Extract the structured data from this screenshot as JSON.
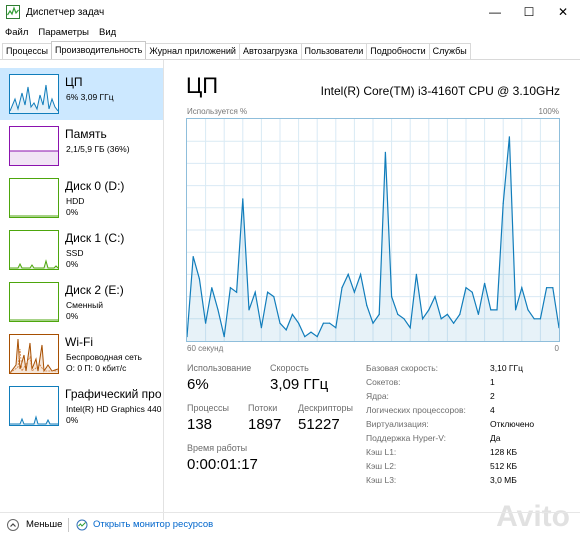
{
  "window": {
    "title": "Диспетчер задач",
    "minimize_glyph": "—",
    "maximize_glyph": "☐",
    "close_glyph": "✕"
  },
  "menu": [
    "Файл",
    "Параметры",
    "Вид"
  ],
  "tabs": [
    "Процессы",
    "Производительность",
    "Журнал приложений",
    "Автозагрузка",
    "Пользователи",
    "Подробности",
    "Службы"
  ],
  "active_tab": "Производительность",
  "sidebar": {
    "items": [
      {
        "title": "ЦП",
        "lines": [
          "6% 3,09 ГГц"
        ],
        "color": "#117dbb"
      },
      {
        "title": "Память",
        "lines": [
          "2,1/5,9 ГБ (36%)"
        ],
        "color": "#8b12ae"
      },
      {
        "title": "Диск 0 (D:)",
        "lines": [
          "HDD",
          "0%"
        ],
        "color": "#4da60c"
      },
      {
        "title": "Диск 1 (C:)",
        "lines": [
          "SSD",
          "0%"
        ],
        "color": "#4da60c"
      },
      {
        "title": "Диск 2 (E:)",
        "lines": [
          "Сменный",
          "0%"
        ],
        "color": "#4da60c"
      },
      {
        "title": "Wi-Fi",
        "lines": [
          "Беспроводная сеть",
          "О: 0 П: 0 кбит/с"
        ],
        "color": "#a74f01"
      },
      {
        "title": "Графический про",
        "lines": [
          "Intel(R) HD Graphics 440",
          "0%"
        ],
        "color": "#117dbb"
      }
    ]
  },
  "main": {
    "title": "ЦП",
    "cpu_name": "Intel(R) Core(TM) i3-4160T CPU @ 3.10GHz",
    "graph_top_left": "Используется %",
    "graph_top_right": "100%",
    "graph_bottom_left": "60 секунд",
    "graph_bottom_right": "0",
    "stats": {
      "usage_label": "Использование",
      "usage_value": "6%",
      "speed_label": "Скорость",
      "speed_value": "3,09 ГГц",
      "processes_label": "Процессы",
      "processes_value": "138",
      "threads_label": "Потоки",
      "threads_value": "1897",
      "handles_label": "Дескрипторы",
      "handles_value": "51227",
      "uptime_label": "Время работы",
      "uptime_value": "0:00:01:17"
    },
    "specs": [
      {
        "label": "Базовая скорость:",
        "value": "3,10 ГГц"
      },
      {
        "label": "Сокетов:",
        "value": "1"
      },
      {
        "label": "Ядра:",
        "value": "2"
      },
      {
        "label": "Логических процессоров:",
        "value": "4"
      },
      {
        "label": "Виртуализация:",
        "value": "Отключено"
      },
      {
        "label": "Поддержка Hyper-V:",
        "value": "Да"
      },
      {
        "label": "Кэш L1:",
        "value": "128 КБ"
      },
      {
        "label": "Кэш L2:",
        "value": "512 КБ"
      },
      {
        "label": "Кэш L3:",
        "value": "3,0 МБ"
      }
    ]
  },
  "footer": {
    "fewer_label": "Меньше",
    "monitor_link": "Открыть монитор ресурсов"
  },
  "watermark": "Avito",
  "chart_data": {
    "type": "area",
    "xlabel": "60 секунд",
    "ylabel": "Используется %",
    "ylim": [
      0,
      100
    ],
    "x": [
      60,
      59,
      58,
      57,
      56,
      55,
      54,
      53,
      52,
      51,
      50,
      49,
      48,
      47,
      46,
      45,
      44,
      43,
      42,
      41,
      40,
      39,
      38,
      37,
      36,
      35,
      34,
      33,
      32,
      31,
      30,
      29,
      28,
      27,
      26,
      25,
      24,
      23,
      22,
      21,
      20,
      19,
      18,
      17,
      16,
      15,
      14,
      13,
      12,
      11,
      10,
      9,
      8,
      7,
      6,
      5,
      4,
      3,
      2,
      1,
      0
    ],
    "series": [
      {
        "values": [
          2,
          38,
          28,
          8,
          24,
          14,
          2,
          24,
          22,
          64,
          14,
          22,
          6,
          22,
          20,
          8,
          5,
          12,
          8,
          2,
          4,
          2,
          8,
          8,
          6,
          24,
          30,
          22,
          30,
          16,
          8,
          12,
          85,
          20,
          12,
          10,
          6,
          30,
          10,
          14,
          20,
          10,
          12,
          8,
          12,
          24,
          22,
          12,
          26,
          14,
          14,
          62,
          92,
          14,
          24,
          14,
          10,
          10,
          24,
          24,
          6
        ]
      }
    ]
  }
}
